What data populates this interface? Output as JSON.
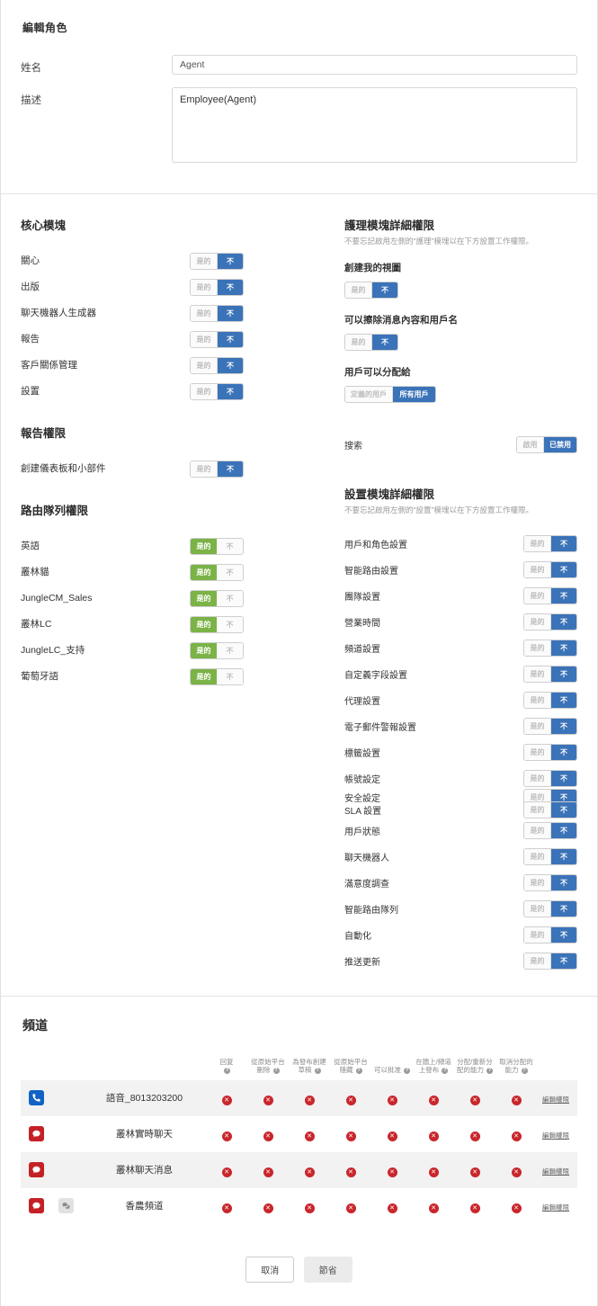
{
  "form": {
    "title": "編輯角色",
    "name_label": "姓名",
    "name_value": "Agent",
    "desc_label": "描述",
    "desc_value": "Employee(Agent)"
  },
  "toggle_labels": {
    "yes": "是的",
    "no": "不",
    "enabled": "啟用",
    "disabled": "已禁用",
    "defined_users": "定義的用戶",
    "all_users": "所有用戶"
  },
  "colors": {
    "blue": "#3b73b9",
    "green": "#7bb347",
    "red": "#c9262c",
    "phone_icon": "#1264c4",
    "chat_icon": "#c42126"
  },
  "core_modules": {
    "heading": "核心模塊",
    "items": [
      {
        "label": "關心",
        "value": "no"
      },
      {
        "label": "出版",
        "value": "no"
      },
      {
        "label": "聊天機器人生成器",
        "value": "no"
      },
      {
        "label": "報告",
        "value": "no"
      },
      {
        "label": "客戶關係管理",
        "value": "no"
      },
      {
        "label": "設置",
        "value": "no"
      }
    ]
  },
  "report_permissions": {
    "heading": "報告權限",
    "items": [
      {
        "label": "創建儀表板和小部件",
        "value": "no"
      }
    ]
  },
  "routing_queue_permissions": {
    "heading": "路由隊列權限",
    "items": [
      {
        "label": "英語",
        "value": "yes"
      },
      {
        "label": "叢林貓",
        "value": "yes"
      },
      {
        "label": "JungleCM_Sales",
        "value": "yes"
      },
      {
        "label": "叢林LC",
        "value": "yes"
      },
      {
        "label": "JungleLC_支持",
        "value": "yes"
      },
      {
        "label": "葡萄牙語",
        "value": "yes"
      }
    ]
  },
  "care_module": {
    "heading": "護理模塊詳細權限",
    "subtext": "不要忘記啟用左側的\"護理\"模塊以在下方設置工作權限。",
    "blocks": [
      {
        "label": "創建我的視圖",
        "value": "no"
      },
      {
        "label": "可以擦除消息內容和用戶名",
        "value": "no"
      }
    ],
    "assign_block": {
      "label": "用戶可以分配給",
      "value": "all_users"
    },
    "search_row": {
      "label": "搜索",
      "value": "disabled"
    }
  },
  "settings_module": {
    "heading": "設置模塊詳細權限",
    "subtext": "不要忘記啟用左側的\"設置\"模塊以在下方設置工作權限。",
    "items": [
      {
        "label": "用戶和角色設置",
        "value": "no"
      },
      {
        "label": "智能路由設置",
        "value": "no"
      },
      {
        "label": "團隊設置",
        "value": "no"
      },
      {
        "label": "營業時間",
        "value": "no"
      },
      {
        "label": "頻道設置",
        "value": "no"
      },
      {
        "label": "自定義字段設置",
        "value": "no"
      },
      {
        "label": "代理設置",
        "value": "no"
      },
      {
        "label": "電子郵件警報設置",
        "value": "no"
      },
      {
        "label": "標籤設置",
        "value": "no"
      },
      {
        "label": "帳號設定",
        "value": "no"
      }
    ],
    "overlap_items": [
      {
        "label": "安全設定",
        "value": "no"
      },
      {
        "label": "SLA 設置",
        "value": "no"
      }
    ],
    "items_after": [
      {
        "label": "用戶狀態",
        "value": "no"
      },
      {
        "label": "聊天機器人",
        "value": "no"
      },
      {
        "label": "滿意度調查",
        "value": "no"
      },
      {
        "label": "智能路由隊列",
        "value": "no"
      },
      {
        "label": "自動化",
        "value": "no"
      },
      {
        "label": "推送更新",
        "value": "no"
      }
    ]
  },
  "channels": {
    "heading": "頻道",
    "columns": [
      "回复",
      "從原始平台刪除",
      "為發布創建草稿",
      "從原始平台隱藏",
      "可以批准",
      "在牆上/頻道上發布",
      "分配/重新分配的能力",
      "取消分配的能力"
    ],
    "edit_link": "編輯權限",
    "rows": [
      {
        "icon": "phone-icon",
        "sub_icon": null,
        "name": "語音_8013203200",
        "permissions": [
          "no",
          "no",
          "no",
          "no",
          "no",
          "no",
          "no",
          "no"
        ]
      },
      {
        "icon": "chat-icon",
        "sub_icon": null,
        "name": "叢林實時聊天",
        "permissions": [
          "no",
          "no",
          "no",
          "no",
          "no",
          "no",
          "no",
          "no"
        ]
      },
      {
        "icon": "chat-icon",
        "sub_icon": null,
        "name": "叢林聊天消息",
        "permissions": [
          "no",
          "no",
          "no",
          "no",
          "no",
          "no",
          "no",
          "no"
        ]
      },
      {
        "icon": "chat-icon",
        "sub_icon": "group-chat-icon",
        "name": "香農頻道",
        "permissions": [
          "no",
          "no",
          "no",
          "no",
          "no",
          "no",
          "no",
          "no"
        ]
      }
    ]
  },
  "footer": {
    "cancel": "取消",
    "save": "節省"
  }
}
